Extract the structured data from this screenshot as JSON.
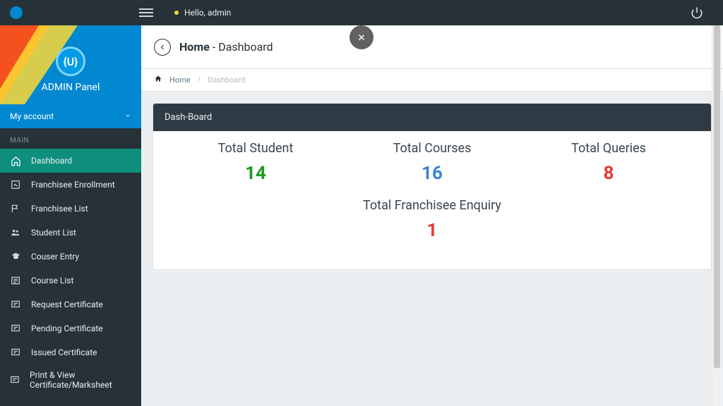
{
  "topbar": {
    "greeting": "Hello, admin"
  },
  "brand": {
    "title": "ADMIN Panel",
    "logo_text": "{U}"
  },
  "my_account": {
    "label": "My account"
  },
  "sidebar": {
    "section": "MAIN",
    "items": [
      {
        "label": "Dashboard"
      },
      {
        "label": "Franchisee Enrollment"
      },
      {
        "label": "Franchisee List"
      },
      {
        "label": "Student List"
      },
      {
        "label": "Couser Entry"
      },
      {
        "label": "Course List"
      },
      {
        "label": "Request Certificate"
      },
      {
        "label": "Pending Certificate"
      },
      {
        "label": "Issued Certificate"
      },
      {
        "label": "Print & View Certificate/Marksheet"
      }
    ]
  },
  "page": {
    "heading_bold": "Home",
    "heading_thin": " - Dashboard"
  },
  "breadcrumb": {
    "home": "Home",
    "current": "Dashboard"
  },
  "card": {
    "title": "Dash-Board"
  },
  "stats": {
    "total_student": {
      "label": "Total Student",
      "value": "14"
    },
    "total_courses": {
      "label": "Total Courses",
      "value": "16"
    },
    "total_queries": {
      "label": "Total Queries",
      "value": "8"
    },
    "total_enquiry": {
      "label": "Total Franchisee Enquiry",
      "value": "1"
    }
  },
  "colors": {
    "green": "#1b9e20",
    "blue": "#3b82d6",
    "red": "#e53935",
    "topbar": "#263238",
    "accent": "#0288d1",
    "teal_active": "#0f8e7e"
  }
}
